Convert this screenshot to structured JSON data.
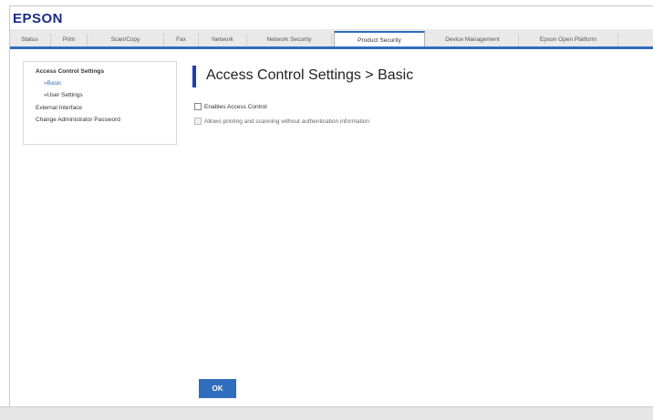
{
  "header": {
    "logo": "EPSON"
  },
  "tabs": [
    {
      "label": "Status"
    },
    {
      "label": "Print"
    },
    {
      "label": "Scan/Copy"
    },
    {
      "label": "Fax"
    },
    {
      "label": "Network"
    },
    {
      "label": "Network Security"
    },
    {
      "label": "Product Security",
      "active": true
    },
    {
      "label": "Device Management"
    },
    {
      "label": "Epson Open Platform"
    }
  ],
  "nav": {
    "section": "Access Control Settings",
    "basic": "»Basic",
    "user_settings": "»User Settings",
    "external_interface": "External Interface",
    "change_password": "Change Administrator Password"
  },
  "main": {
    "title": "Access Control Settings > Basic",
    "options": [
      {
        "label": "Enables Access Control",
        "checked": false,
        "disabled": false
      },
      {
        "label": "Allows printing and scanning without authentication information",
        "checked": false,
        "disabled": true
      }
    ],
    "ok_label": "OK"
  },
  "colors": {
    "accent": "#2f6dbf",
    "title_bar": "#1a3fbf",
    "logo": "#1a2a8c"
  }
}
